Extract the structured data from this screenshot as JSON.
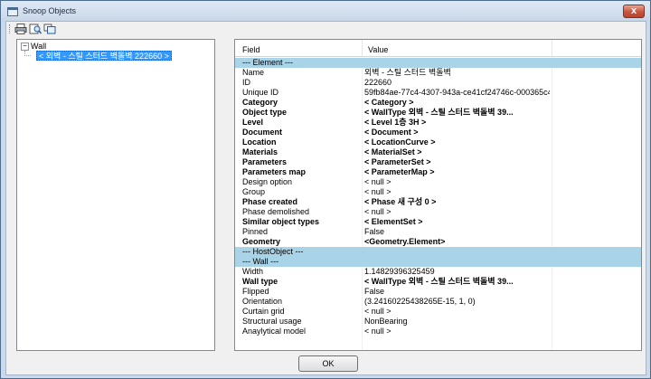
{
  "window": {
    "title": "Snoop Objects",
    "close_label": "x"
  },
  "tree": {
    "root": "Wall",
    "expander": "−",
    "selected_child": "< 외벽 - 스틸 스터드 벽돌벽  222660 >"
  },
  "grid": {
    "headers": {
      "field": "Field",
      "value": "Value"
    },
    "rows": [
      {
        "field": "--- Element ---",
        "value": "",
        "type": "section"
      },
      {
        "field": "Name",
        "value": "외벽 - 스틸 스터드 벽돌벽",
        "type": "normal"
      },
      {
        "field": "ID",
        "value": "222660",
        "type": "normal"
      },
      {
        "field": "Unique ID",
        "value": "59fb84ae-77c4-4307-943a-ce41cf24746c-000365c4",
        "type": "normal"
      },
      {
        "field": "Category",
        "value": "< Category >",
        "type": "bold"
      },
      {
        "field": "Object type",
        "value": "< WallType  외벽 - 스틸 스터드 벽돌벽   39...",
        "type": "bold"
      },
      {
        "field": "Level",
        "value": "< Level  1층  3H >",
        "type": "bold"
      },
      {
        "field": "Document",
        "value": "< Document >",
        "type": "bold"
      },
      {
        "field": "Location",
        "value": "< LocationCurve >",
        "type": "bold"
      },
      {
        "field": "Materials",
        "value": "< MaterialSet >",
        "type": "bold"
      },
      {
        "field": "Parameters",
        "value": "< ParameterSet >",
        "type": "bold"
      },
      {
        "field": "Parameters map",
        "value": "< ParameterMap >",
        "type": "bold"
      },
      {
        "field": "Design option",
        "value": "< null >",
        "type": "normal"
      },
      {
        "field": "Group",
        "value": "< null >",
        "type": "normal"
      },
      {
        "field": "Phase created",
        "value": "< Phase  새 구성      0 >",
        "type": "bold"
      },
      {
        "field": "Phase demolished",
        "value": "< null >",
        "type": "normal"
      },
      {
        "field": "Similar object types",
        "value": "< ElementSet >",
        "type": "bold"
      },
      {
        "field": "Pinned",
        "value": "False",
        "type": "normal"
      },
      {
        "field": "Geometry",
        "value": "<Geometry.Element>",
        "type": "bold"
      },
      {
        "field": "--- HostObject ---",
        "value": "",
        "type": "section"
      },
      {
        "field": "--- Wall ---",
        "value": "",
        "type": "section"
      },
      {
        "field": "Width",
        "value": "1.14829396325459",
        "type": "normal"
      },
      {
        "field": "Wall type",
        "value": "< WallType  외벽 - 스틸 스터드 벽돌벽   39...",
        "type": "bold"
      },
      {
        "field": "Flipped",
        "value": "False",
        "type": "normal"
      },
      {
        "field": "Orientation",
        "value": "(3.24160225438265E-15, 1, 0)",
        "type": "normal"
      },
      {
        "field": "Curtain grid",
        "value": "< null >",
        "type": "normal"
      },
      {
        "field": "Structural usage",
        "value": "NonBearing",
        "type": "normal"
      },
      {
        "field": "Anaylytical model",
        "value": "< null >",
        "type": "normal"
      }
    ]
  },
  "buttons": {
    "ok_label": "OK"
  },
  "icons": {
    "window_icon": "app-window-icon",
    "toolbar": [
      "print-icon",
      "print-preview-icon",
      "copy-icon"
    ]
  },
  "colors": {
    "selection": "#3399ff",
    "section_row": "#a9d3e6",
    "close_button": "#c7533d"
  }
}
